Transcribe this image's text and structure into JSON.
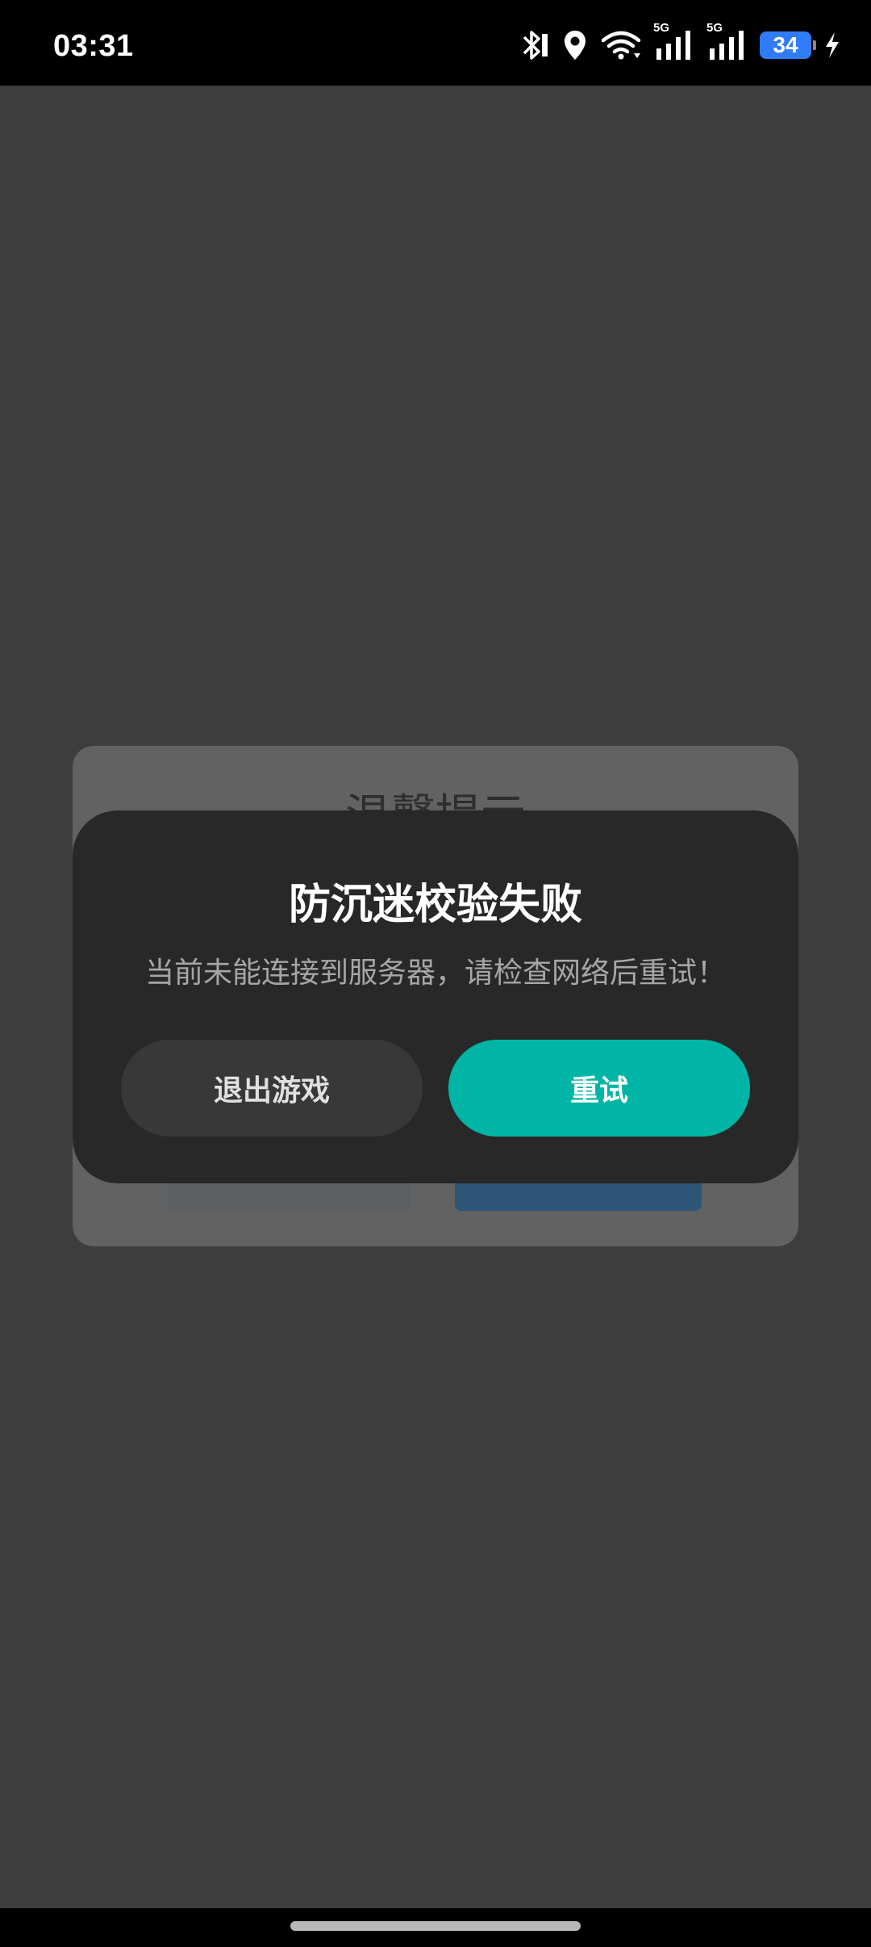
{
  "status_bar": {
    "time": "03:31",
    "network_1": "5G",
    "network_2": "5G",
    "battery_level": "34",
    "icons": [
      "bluetooth-icon",
      "location-icon",
      "wifi-icon",
      "signal-icon",
      "signal-icon",
      "battery-icon",
      "charging-icon"
    ]
  },
  "background_dialog": {
    "title": "温馨提示"
  },
  "dialog": {
    "title": "防沉迷校验失败",
    "message": "当前未能连接到服务器，请检查网络后重试！",
    "exit_label": "退出游戏",
    "retry_label": "重试"
  },
  "colors": {
    "background": "#3d3d3d",
    "dialog_bg": "#282828",
    "retry_accent": "#00b5a5",
    "exit_bg": "#383838",
    "battery": "#2f7cf6"
  }
}
